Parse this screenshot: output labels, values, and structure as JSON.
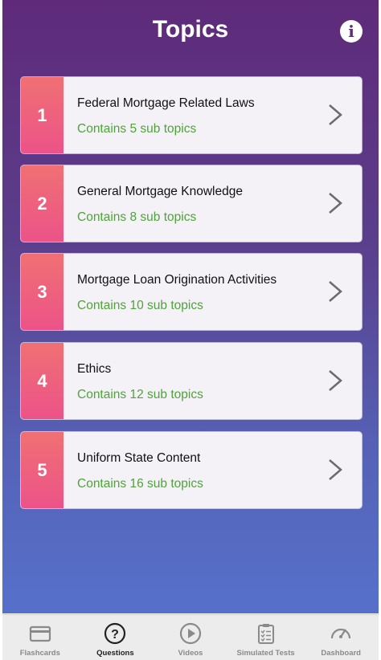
{
  "header": {
    "title": "Topics",
    "info_icon": "info-icon"
  },
  "topics": [
    {
      "number": "1",
      "name": "Federal Mortgage Related Laws",
      "sub": "Contains 5 sub topics"
    },
    {
      "number": "2",
      "name": "General Mortgage Knowledge",
      "sub": "Contains 8 sub topics"
    },
    {
      "number": "3",
      "name": "Mortgage Loan Origination Activities",
      "sub": "Contains 10 sub topics"
    },
    {
      "number": "4",
      "name": "Ethics",
      "sub": "Contains 12 sub topics"
    },
    {
      "number": "5",
      "name": "Uniform State Content",
      "sub": "Contains 16 sub topics"
    }
  ],
  "tabbar": [
    {
      "label": "Flashcards",
      "icon": "card-icon",
      "active": false
    },
    {
      "label": "Questions",
      "icon": "question-icon",
      "active": true
    },
    {
      "label": "Videos",
      "icon": "play-icon",
      "active": false
    },
    {
      "label": "Simulated Tests",
      "icon": "clipboard-icon",
      "active": false
    },
    {
      "label": "Dashboard",
      "icon": "gauge-icon",
      "active": false
    }
  ],
  "colors": {
    "gradient_top": "#5f2a7a",
    "gradient_bottom": "#5671cb",
    "number_badge": "#ec5388",
    "sub_text": "#4fa33a"
  }
}
